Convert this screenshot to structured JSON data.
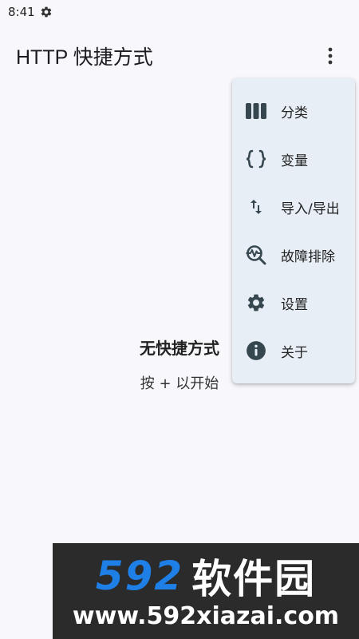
{
  "status_bar": {
    "time": "8:41",
    "icon": "gear-icon"
  },
  "app_bar": {
    "title": "HTTP 快捷方式",
    "overflow_icon": "more-vert-icon"
  },
  "menu": {
    "items": [
      {
        "label": "分类",
        "icon": "columns-icon"
      },
      {
        "label": "变量",
        "icon": "braces-icon"
      },
      {
        "label": "导入/导出",
        "icon": "swap-vert-icon"
      },
      {
        "label": "故障排除",
        "icon": "troubleshoot-icon"
      },
      {
        "label": "设置",
        "icon": "gear-icon"
      },
      {
        "label": "关于",
        "icon": "info-icon"
      }
    ]
  },
  "empty_state": {
    "title": "无快捷方式",
    "subtitle": "按 + 以开始"
  },
  "watermark": {
    "brand_number": "592",
    "brand_name": "软件园",
    "url": "www.592xiazai.com"
  }
}
